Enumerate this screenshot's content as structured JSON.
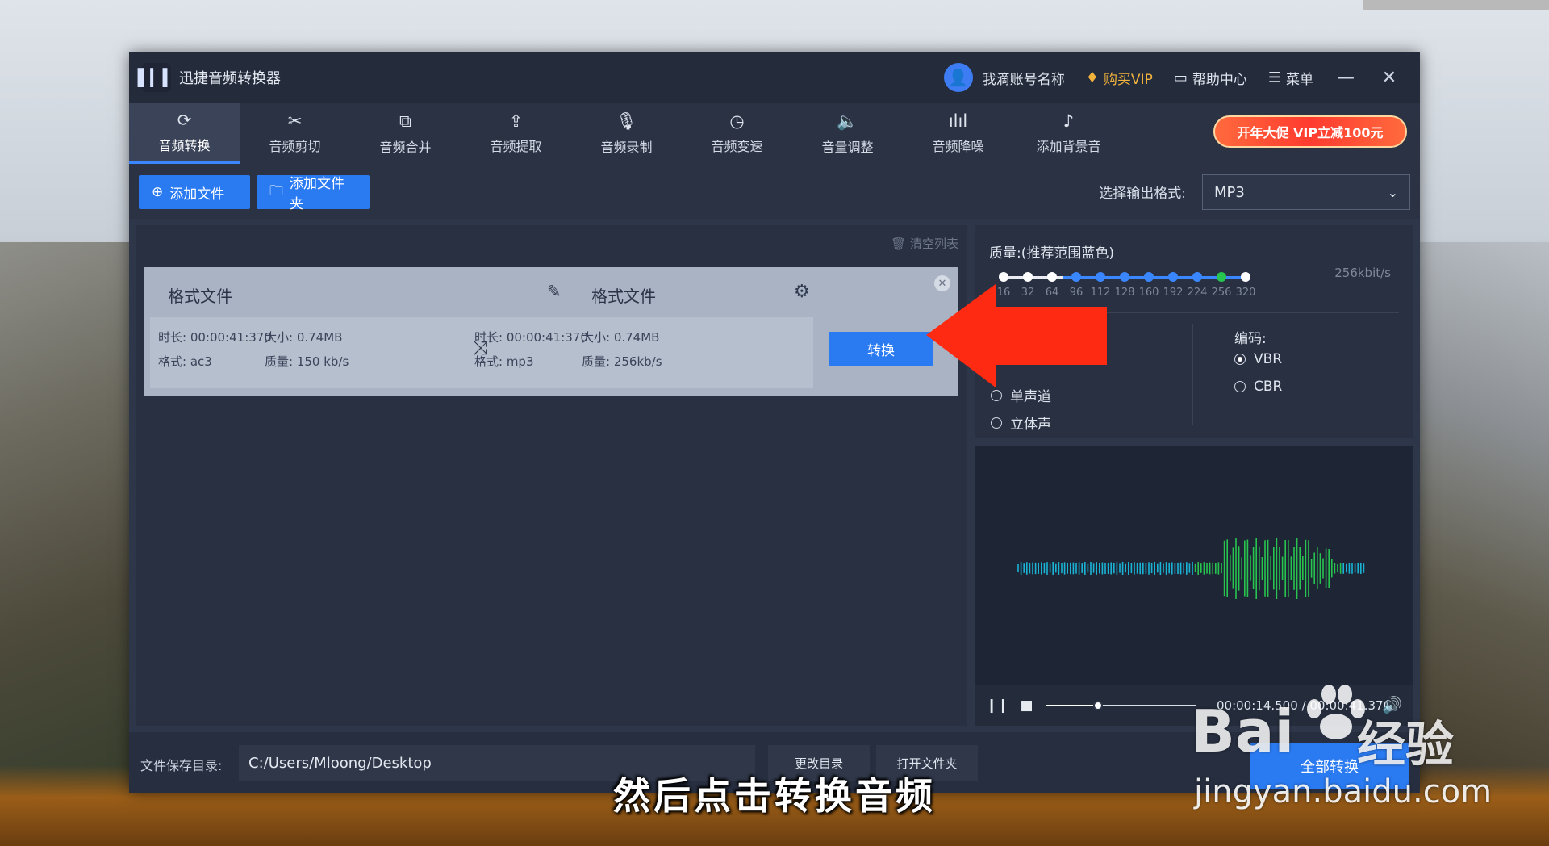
{
  "window": {
    "title": "迅捷音频转换器",
    "user_name": "我滴账号名称",
    "vip_label": "购买VIP",
    "help_label": "帮助中心",
    "menu_label": "菜单"
  },
  "toolbar": {
    "tools": [
      {
        "label": "音频转换",
        "icon": "convert-icon"
      },
      {
        "label": "音频剪切",
        "icon": "scissors-icon"
      },
      {
        "label": "音频合并",
        "icon": "merge-icon"
      },
      {
        "label": "音频提取",
        "icon": "extract-icon"
      },
      {
        "label": "音频录制",
        "icon": "microphone-icon"
      },
      {
        "label": "音频变速",
        "icon": "speed-icon"
      },
      {
        "label": "音量调整",
        "icon": "volume-icon"
      },
      {
        "label": "音频降噪",
        "icon": "denoise-icon"
      },
      {
        "label": "添加背景音",
        "icon": "music-icon"
      }
    ],
    "active_tool": "音频转换",
    "promo": "开年大促 VIP立减100元"
  },
  "actions": {
    "add_file": "添加文件",
    "add_folder": "添加文件夹",
    "output_format_label": "选择输出格式:",
    "output_format": "MP3"
  },
  "file_list": {
    "clear_label": "清空列表",
    "files": [
      {
        "source_name": "格式文件",
        "target_name": "格式文件",
        "source": {
          "duration": "时长: 00:00:41:370",
          "size": "大小: 0.74MB",
          "format": "格式: ac3",
          "quality": "质量: 150 kb/s"
        },
        "target": {
          "duration": "时长: 00:00:41:370",
          "size": "大小: 0.74MB",
          "format": "格式: mp3",
          "quality": "质量: 256kb/s"
        },
        "convert_label": "转换"
      }
    ]
  },
  "settings": {
    "quality_title": "质量:(推荐范围蓝色)",
    "quality_ticks": [
      "16",
      "32",
      "64",
      "96",
      "112",
      "128",
      "160",
      "192",
      "224",
      "256",
      "320"
    ],
    "quality_selected": "256",
    "quality_value": "256kbit/s",
    "channels": [
      {
        "label": "单声道",
        "selected": false
      },
      {
        "label": "立体声",
        "selected": false
      }
    ],
    "encoding_label": "编码:",
    "encodings": [
      {
        "label": "VBR",
        "selected": true
      },
      {
        "label": "CBR",
        "selected": false
      }
    ]
  },
  "player": {
    "time": "00:00:14.500 / 00:00:41.370",
    "progress": 0.35
  },
  "footer": {
    "save_dir_label": "文件保存目录:",
    "save_dir": "C:/Users/Mloong/Desktop",
    "change_dir": "更改目录",
    "open_folder": "打开文件夹",
    "convert_all": "全部转换"
  },
  "overlay": {
    "subtitle": "然后点击转换音频",
    "watermark_brand": "Bai",
    "watermark_cn": "经验",
    "watermark_url": "jingyan.baidu.com",
    "arrow_color": "#ff2a12"
  },
  "colors": {
    "accent": "#2a7bf2",
    "app_bg": "#2e3649",
    "vip": "#f2b33c",
    "waveform_low": "#1ab3d6",
    "waveform_high": "#27c44f"
  }
}
